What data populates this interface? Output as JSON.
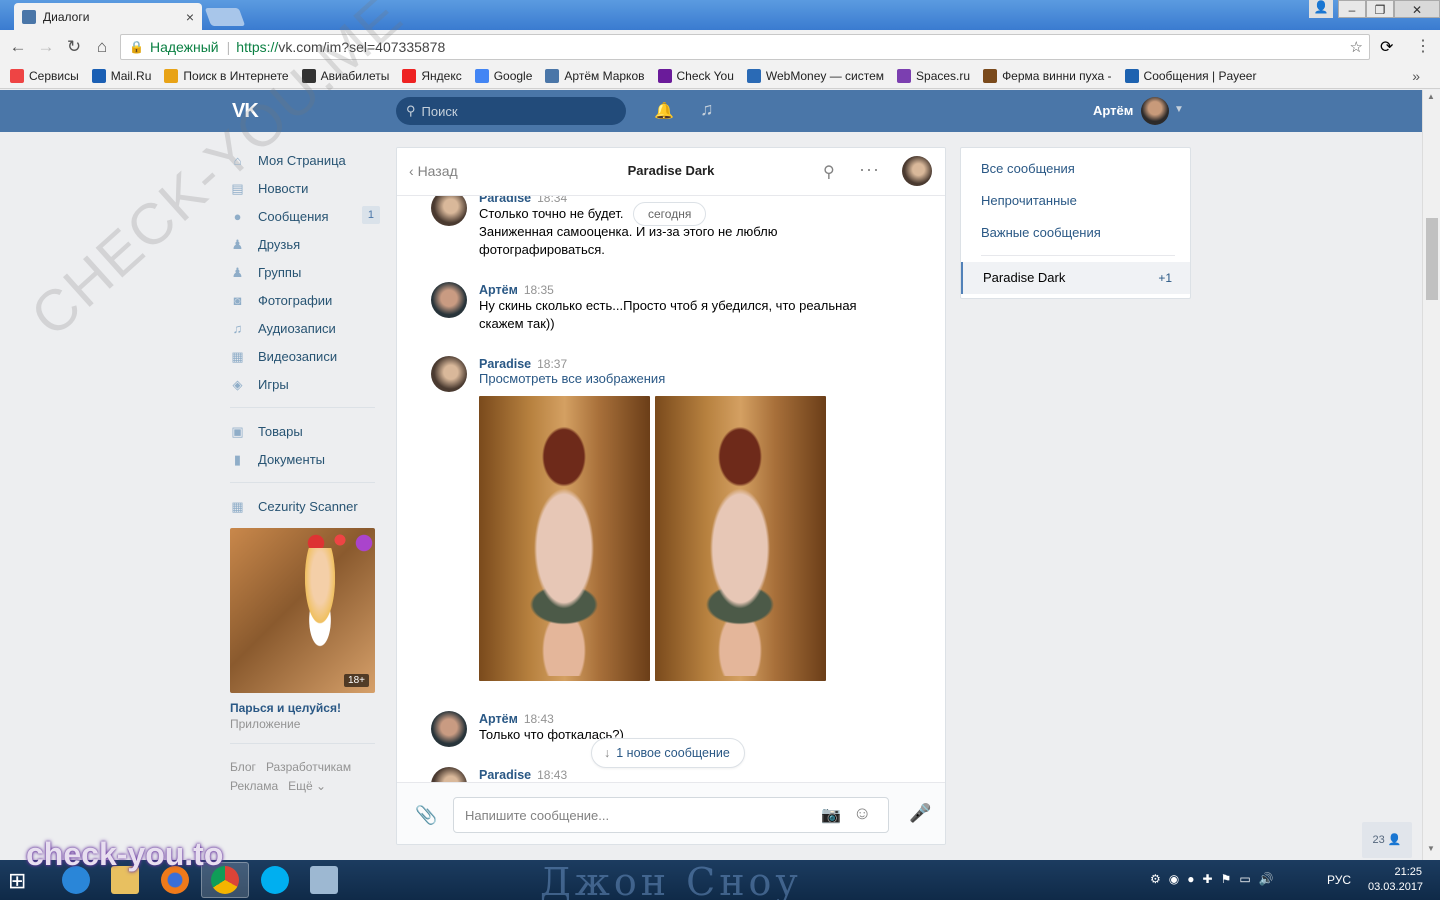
{
  "browser": {
    "tab_title": "Диалоги",
    "tab_close": "×",
    "secure_label": "Надежный",
    "url_proto": "https://",
    "url_rest": "vk.com/im?sel=407335878",
    "bookmarks": [
      {
        "label": "Сервисы",
        "color": "#e44"
      },
      {
        "label": "Mail.Ru",
        "color": "#1a5fb4"
      },
      {
        "label": "Поиск в Интернете",
        "color": "#e8a317"
      },
      {
        "label": "Авиабилеты",
        "color": "#333"
      },
      {
        "label": "Яндекс",
        "color": "#e22"
      },
      {
        "label": "Google",
        "color": "#4285f4"
      },
      {
        "label": "Артём Марков",
        "color": "#4a76a8"
      },
      {
        "label": "Check You",
        "color": "#6a1b9a"
      },
      {
        "label": "WebMoney — систем",
        "color": "#2a6ab5"
      },
      {
        "label": "Spaces.ru",
        "color": "#7b3fb0"
      },
      {
        "label": "Ферма винни пуха -",
        "color": "#7a4a1c"
      },
      {
        "label": "Сообщения | Payeer",
        "color": "#1d62b0"
      }
    ],
    "more": "»"
  },
  "vk": {
    "search_placeholder": "Поиск",
    "user_name": "Артём"
  },
  "nav": {
    "items": [
      {
        "label": "Моя Страница",
        "icon": "⌂"
      },
      {
        "label": "Новости",
        "icon": "▤"
      },
      {
        "label": "Сообщения",
        "icon": "●",
        "count": "1"
      },
      {
        "label": "Друзья",
        "icon": "♟"
      },
      {
        "label": "Группы",
        "icon": "♟"
      },
      {
        "label": "Фотографии",
        "icon": "◙"
      },
      {
        "label": "Аудиозаписи",
        "icon": "♫"
      },
      {
        "label": "Видеозаписи",
        "icon": "▦"
      },
      {
        "label": "Игры",
        "icon": "◈"
      }
    ],
    "items2": [
      {
        "label": "Товары",
        "icon": "▣"
      },
      {
        "label": "Документы",
        "icon": "▮"
      }
    ],
    "items3": [
      {
        "label": "Cezurity Scanner",
        "icon": "▦"
      }
    ],
    "ad_title": "Парься и целуйся!",
    "ad_sub": "Приложение",
    "ad_age": "18+",
    "foot": [
      "Блог",
      "Разработчикам",
      "Реклама",
      "Ещё ⌄"
    ]
  },
  "chat": {
    "back_label": "Назад",
    "title": "Paradise Dark",
    "date_pill": "сегодня",
    "messages": [
      {
        "author": "Paradise",
        "time": "18:34",
        "lines": [
          "Столько точно не будет.",
          "Заниженная самооценка. И из-за этого не люблю фотографироваться."
        ]
      },
      {
        "author": "Артём",
        "time": "18:35",
        "lines": [
          "Ну скинь сколько есть...Просто чтоб я убедился, что реальная скажем так))"
        ]
      },
      {
        "author": "Paradise",
        "time": "18:37",
        "link": "Просмотреть все изображения"
      },
      {
        "author": "Артём",
        "time": "18:43",
        "lines": [
          "Только что фоткалась?)"
        ]
      },
      {
        "author": "Paradise",
        "time": "18:43"
      }
    ],
    "new_message_label": "1 новое сообщение",
    "input_placeholder": "Напишите сообщение..."
  },
  "filters": {
    "items": [
      "Все сообщения",
      "Непрочитанные",
      "Важные сообщения"
    ],
    "active": "Paradise Dark",
    "active_badge": "+1"
  },
  "friends_online": "23",
  "watermark": "CHECK-YOU.ME",
  "watermark2": "check-you.to",
  "taskbar": {
    "lang": "РУС",
    "time": "21:25",
    "date": "03.03.2017"
  }
}
